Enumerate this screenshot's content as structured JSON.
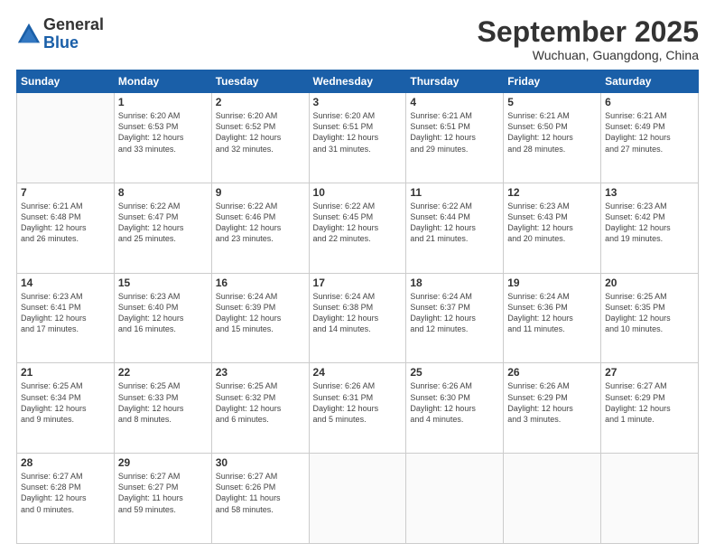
{
  "logo": {
    "general": "General",
    "blue": "Blue"
  },
  "header": {
    "month": "September 2025",
    "location": "Wuchuan, Guangdong, China"
  },
  "weekdays": [
    "Sunday",
    "Monday",
    "Tuesday",
    "Wednesday",
    "Thursday",
    "Friday",
    "Saturday"
  ],
  "weeks": [
    [
      {
        "day": "",
        "info": ""
      },
      {
        "day": "1",
        "info": "Sunrise: 6:20 AM\nSunset: 6:53 PM\nDaylight: 12 hours\nand 33 minutes."
      },
      {
        "day": "2",
        "info": "Sunrise: 6:20 AM\nSunset: 6:52 PM\nDaylight: 12 hours\nand 32 minutes."
      },
      {
        "day": "3",
        "info": "Sunrise: 6:20 AM\nSunset: 6:51 PM\nDaylight: 12 hours\nand 31 minutes."
      },
      {
        "day": "4",
        "info": "Sunrise: 6:21 AM\nSunset: 6:51 PM\nDaylight: 12 hours\nand 29 minutes."
      },
      {
        "day": "5",
        "info": "Sunrise: 6:21 AM\nSunset: 6:50 PM\nDaylight: 12 hours\nand 28 minutes."
      },
      {
        "day": "6",
        "info": "Sunrise: 6:21 AM\nSunset: 6:49 PM\nDaylight: 12 hours\nand 27 minutes."
      }
    ],
    [
      {
        "day": "7",
        "info": "Sunrise: 6:21 AM\nSunset: 6:48 PM\nDaylight: 12 hours\nand 26 minutes."
      },
      {
        "day": "8",
        "info": "Sunrise: 6:22 AM\nSunset: 6:47 PM\nDaylight: 12 hours\nand 25 minutes."
      },
      {
        "day": "9",
        "info": "Sunrise: 6:22 AM\nSunset: 6:46 PM\nDaylight: 12 hours\nand 23 minutes."
      },
      {
        "day": "10",
        "info": "Sunrise: 6:22 AM\nSunset: 6:45 PM\nDaylight: 12 hours\nand 22 minutes."
      },
      {
        "day": "11",
        "info": "Sunrise: 6:22 AM\nSunset: 6:44 PM\nDaylight: 12 hours\nand 21 minutes."
      },
      {
        "day": "12",
        "info": "Sunrise: 6:23 AM\nSunset: 6:43 PM\nDaylight: 12 hours\nand 20 minutes."
      },
      {
        "day": "13",
        "info": "Sunrise: 6:23 AM\nSunset: 6:42 PM\nDaylight: 12 hours\nand 19 minutes."
      }
    ],
    [
      {
        "day": "14",
        "info": "Sunrise: 6:23 AM\nSunset: 6:41 PM\nDaylight: 12 hours\nand 17 minutes."
      },
      {
        "day": "15",
        "info": "Sunrise: 6:23 AM\nSunset: 6:40 PM\nDaylight: 12 hours\nand 16 minutes."
      },
      {
        "day": "16",
        "info": "Sunrise: 6:24 AM\nSunset: 6:39 PM\nDaylight: 12 hours\nand 15 minutes."
      },
      {
        "day": "17",
        "info": "Sunrise: 6:24 AM\nSunset: 6:38 PM\nDaylight: 12 hours\nand 14 minutes."
      },
      {
        "day": "18",
        "info": "Sunrise: 6:24 AM\nSunset: 6:37 PM\nDaylight: 12 hours\nand 12 minutes."
      },
      {
        "day": "19",
        "info": "Sunrise: 6:24 AM\nSunset: 6:36 PM\nDaylight: 12 hours\nand 11 minutes."
      },
      {
        "day": "20",
        "info": "Sunrise: 6:25 AM\nSunset: 6:35 PM\nDaylight: 12 hours\nand 10 minutes."
      }
    ],
    [
      {
        "day": "21",
        "info": "Sunrise: 6:25 AM\nSunset: 6:34 PM\nDaylight: 12 hours\nand 9 minutes."
      },
      {
        "day": "22",
        "info": "Sunrise: 6:25 AM\nSunset: 6:33 PM\nDaylight: 12 hours\nand 8 minutes."
      },
      {
        "day": "23",
        "info": "Sunrise: 6:25 AM\nSunset: 6:32 PM\nDaylight: 12 hours\nand 6 minutes."
      },
      {
        "day": "24",
        "info": "Sunrise: 6:26 AM\nSunset: 6:31 PM\nDaylight: 12 hours\nand 5 minutes."
      },
      {
        "day": "25",
        "info": "Sunrise: 6:26 AM\nSunset: 6:30 PM\nDaylight: 12 hours\nand 4 minutes."
      },
      {
        "day": "26",
        "info": "Sunrise: 6:26 AM\nSunset: 6:29 PM\nDaylight: 12 hours\nand 3 minutes."
      },
      {
        "day": "27",
        "info": "Sunrise: 6:27 AM\nSunset: 6:29 PM\nDaylight: 12 hours\nand 1 minute."
      }
    ],
    [
      {
        "day": "28",
        "info": "Sunrise: 6:27 AM\nSunset: 6:28 PM\nDaylight: 12 hours\nand 0 minutes."
      },
      {
        "day": "29",
        "info": "Sunrise: 6:27 AM\nSunset: 6:27 PM\nDaylight: 11 hours\nand 59 minutes."
      },
      {
        "day": "30",
        "info": "Sunrise: 6:27 AM\nSunset: 6:26 PM\nDaylight: 11 hours\nand 58 minutes."
      },
      {
        "day": "",
        "info": ""
      },
      {
        "day": "",
        "info": ""
      },
      {
        "day": "",
        "info": ""
      },
      {
        "day": "",
        "info": ""
      }
    ]
  ]
}
